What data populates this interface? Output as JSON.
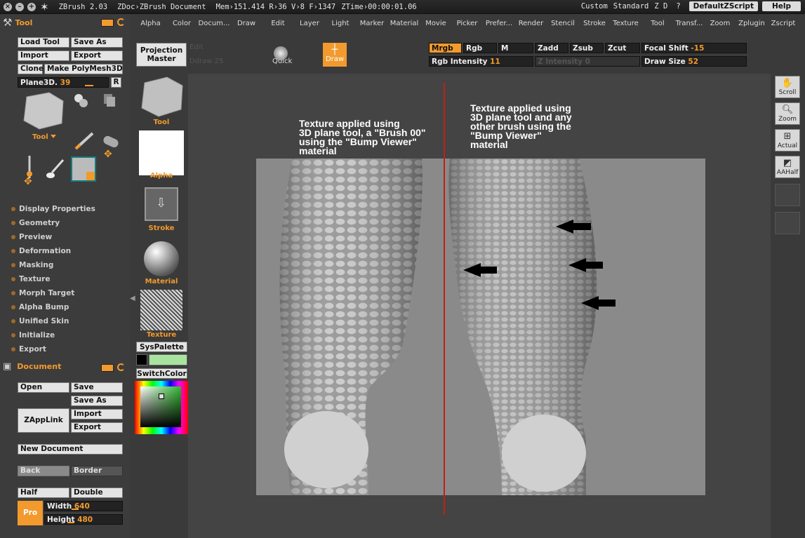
{
  "titlebar": {
    "app": "ZBrush 2.03",
    "doc": "ZDoc›ZBrush Document",
    "stats": "Mem›151.414 R›36 V›8 F›1347",
    "ztime": "ZTime›00:00:01.06",
    "layout": "Custom",
    "standard": "Standard",
    "zd": "Z D",
    "question": "?",
    "script": "DefaultZScript",
    "help": "Help"
  },
  "menu": [
    "Alpha",
    "Color",
    "Docum...",
    "Draw",
    "Edit",
    "Layer",
    "Light",
    "Marker",
    "Material",
    "Movie",
    "Picker",
    "Prefer...",
    "Render",
    "Stencil",
    "Stroke",
    "Texture",
    "Tool",
    "Transf...",
    "Zoom",
    "Zplugin",
    "Zscript"
  ],
  "tool_panel": {
    "title": "Tool",
    "load_tool": "Load Tool",
    "save_as": "Save As",
    "import": "Import",
    "export": "Export",
    "clone": "Clone",
    "make_polymesh": "Make PolyMesh3D",
    "plane_label": "Plane3D.",
    "plane_value": "39",
    "r": "R",
    "tool_dd": "Tool",
    "items": [
      "Display Properties",
      "Geometry",
      "Preview",
      "Deformation",
      "Masking",
      "Texture",
      "Morph Target",
      "Alpha Bump",
      "Unified Skin",
      "Initialize",
      "Export"
    ]
  },
  "document_panel": {
    "title": "Document",
    "open": "Open",
    "save": "Save",
    "save_as": "Save As",
    "zapplink": "ZAppLink",
    "import": "Import",
    "export": "Export",
    "new_document": "New Document",
    "back": "Back",
    "border": "Border",
    "half": "Half",
    "double": "Double",
    "pro": "Pro",
    "width_label": "Width",
    "width_value": "640",
    "height_label": "Height",
    "height_value": "480"
  },
  "palette": {
    "tool": "Tool",
    "alpha": "Alpha",
    "stroke": "Stroke",
    "material": "Material",
    "texture": "Texture",
    "syspalette": "SysPalette",
    "switchcolor": "SwitchColor",
    "secondary_color": "#a8e4a0"
  },
  "shelf": {
    "projection_master": "Projection Master",
    "quick": "Quick",
    "draw": "Draw",
    "mrgb": "Mrgb",
    "rgb": "Rgb",
    "m": "M",
    "zadd": "Zadd",
    "zsub": "Zsub",
    "zcut": "Zcut",
    "rgb_intensity_label": "Rgb Intensity",
    "rgb_intensity_value": "11",
    "z_intensity_label": "Z Intensity",
    "z_intensity_value": "0",
    "focal_shift_label": "Focal Shift",
    "focal_shift_value": "-15",
    "draw_size_label": "Draw Size",
    "draw_size_value": "52",
    "ghost_edit": "Edit",
    "ghost_drawsize": "Ddraw 25"
  },
  "canvas": {
    "annotation_left": [
      "Texture applied using",
      "3D plane tool, a \"Brush 00\"",
      "using the \"Bump Viewer\"",
      "material"
    ],
    "annotation_right": [
      "Texture applied using",
      "3D plane tool and any",
      "other brush using the",
      "\"Bump Viewer\"",
      "material"
    ]
  },
  "right_panel": {
    "scroll": "Scroll",
    "zoom": "Zoom",
    "actual": "Actual",
    "aahalf": "AAHalf"
  },
  "colors": {
    "accent": "#f29a2e",
    "panel": "#3c3c3c",
    "divider_line": "#c31d1d"
  }
}
